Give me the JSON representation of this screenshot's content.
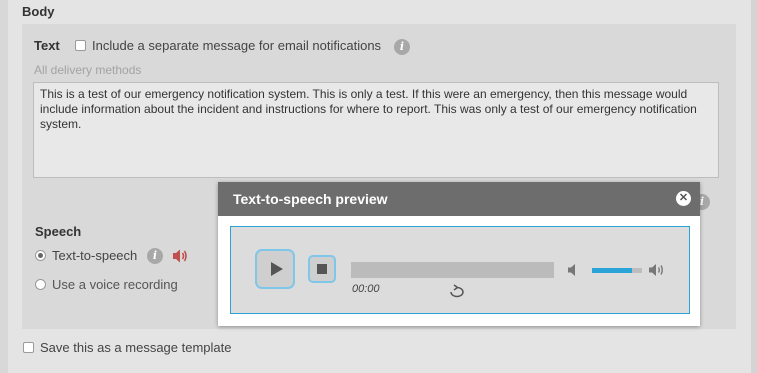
{
  "body_section": {
    "title": "Body"
  },
  "text_section": {
    "label": "Text",
    "email_checkbox_label": "Include a separate message for email notifications",
    "email_checkbox_checked": false,
    "delivery_hint": "All delivery methods",
    "message": "This is a test of our emergency notification system.  This is only a test.  If this were an emergency, then this message would include information about the incident and instructions for where to report.  This was only a test of our emergency notification system."
  },
  "speech_section": {
    "label": "Speech",
    "options": [
      {
        "label": "Text-to-speech",
        "selected": true
      },
      {
        "label": "Use a voice recording",
        "selected": false
      }
    ]
  },
  "template_checkbox": {
    "label": "Save this as a message template",
    "checked": false
  },
  "tts_modal": {
    "title": "Text-to-speech preview",
    "close_icon": "close-icon",
    "player": {
      "time": "00:00",
      "progress": 0,
      "volume": 0.8,
      "accent_color": "#29a3d8"
    }
  },
  "colors": {
    "background": "#e4e4e4",
    "inner_panel": "#d9d9d9",
    "modal_header": "#6d6d6d",
    "speaker_icon": "#c0504d",
    "info_icon": "#a8a8a8"
  },
  "icons": {
    "info": "info-icon",
    "speaker": "speaker-icon",
    "play": "play-icon",
    "stop": "stop-icon",
    "loop": "loop-icon",
    "mute": "volume-mute-icon",
    "volume_max": "volume-max-icon"
  }
}
